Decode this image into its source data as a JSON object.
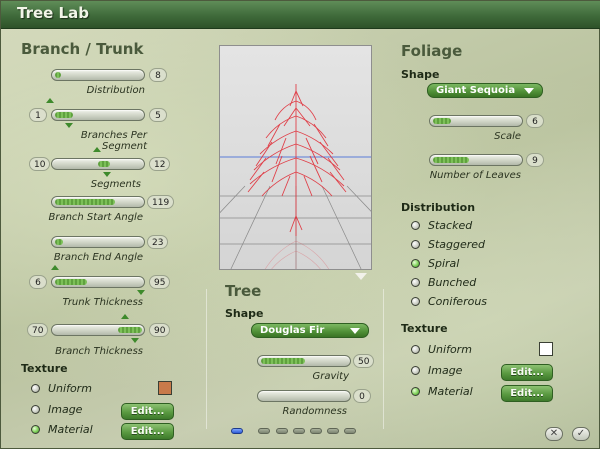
{
  "window": {
    "title": "Tree Lab"
  },
  "branch": {
    "title": "Branch / Trunk",
    "sliders": [
      {
        "label": "Distribution",
        "value": "8",
        "fill": 0.05
      },
      {
        "label": "Branches Per Segment",
        "min": "1",
        "max": "5",
        "fill": 0.2
      },
      {
        "label": "Segments",
        "min": "10",
        "max": "12",
        "fill": 0.5
      },
      {
        "label": "Branch Start Angle",
        "value": "119",
        "fill": 0.65
      },
      {
        "label": "Branch End Angle",
        "value": "23",
        "fill": 0.1
      },
      {
        "label": "Trunk Thickness",
        "min": "6",
        "max": "95",
        "fill": 0.35
      },
      {
        "label": "Branch Thickness",
        "min": "70",
        "max": "90",
        "fill": 0.3
      }
    ],
    "texture": {
      "title": "Texture",
      "options": [
        "Uniform",
        "Image",
        "Material"
      ],
      "selected": "Material",
      "edit_label": "Edit...",
      "swatch_color": "#c87a4a"
    }
  },
  "tree": {
    "title": "Tree",
    "shape_label": "Shape",
    "shape_value": "Douglas Fir",
    "gravity": {
      "label": "Gravity",
      "value": "50",
      "fill": 0.5
    },
    "randomness": {
      "label": "Randomness",
      "value": "0",
      "fill": 0.0
    }
  },
  "foliage": {
    "title": "Foliage",
    "shape_label": "Shape",
    "shape_value": "Giant Sequoia",
    "scale": {
      "label": "Scale",
      "value": "6",
      "fill": 0.2
    },
    "leaves": {
      "label": "Number of Leaves",
      "value": "9",
      "fill": 0.38
    },
    "distribution": {
      "title": "Distribution",
      "options": [
        "Stacked",
        "Staggered",
        "Spiral",
        "Bunched",
        "Coniferous"
      ],
      "selected": "Spiral"
    },
    "texture": {
      "title": "Texture",
      "options": [
        "Uniform",
        "Image",
        "Material"
      ],
      "selected": "Material",
      "edit_label": "Edit...",
      "swatch_color": "#ffffff"
    }
  },
  "pager": {
    "pages": 7,
    "active": 0
  },
  "colors": {
    "accent": "#5a9a41",
    "title_bar": "#3f6a3a",
    "tree": "#e0303a"
  },
  "icons": {
    "close": "close-icon",
    "confirm": "checkmark-icon"
  }
}
